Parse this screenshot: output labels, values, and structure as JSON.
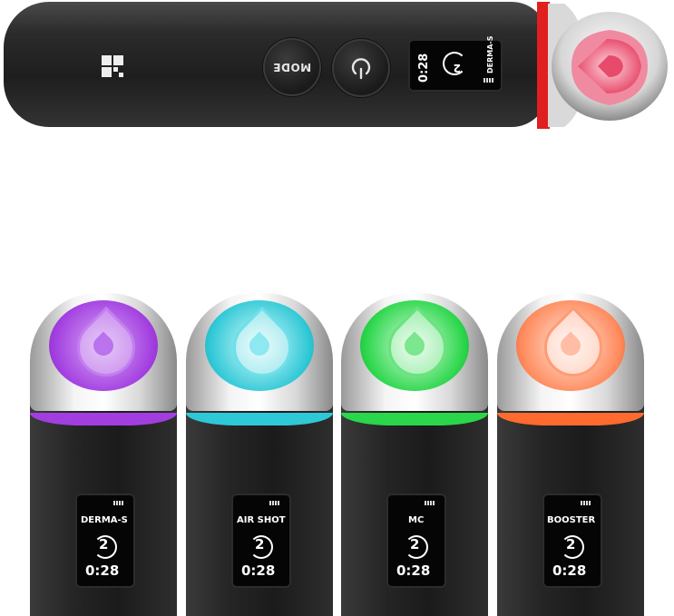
{
  "top_device": {
    "mode_button_label": "MODE",
    "power_icon": "power-icon",
    "screen": {
      "mode": "DERMA-S",
      "level": "2",
      "time": "0:28"
    },
    "light_color": "#e8506f",
    "ring_color": "#e0201e"
  },
  "devices": [
    {
      "mode": "DERMA-S",
      "level": "2",
      "time": "0:28",
      "light_color": "#a23ee0",
      "glow": "#d8a8f5"
    },
    {
      "mode": "AIR SHOT",
      "level": "2",
      "time": "0:28",
      "light_color": "#2fc8d6",
      "glow": "#b8f1f4"
    },
    {
      "mode": "MC",
      "level": "2",
      "time": "0:28",
      "light_color": "#2ad64a",
      "glow": "#b5f3bf"
    },
    {
      "mode": "BOOSTER",
      "level": "2",
      "time": "0:28",
      "light_color": "#ff6a2e",
      "glow": "#ffd0bd"
    }
  ]
}
